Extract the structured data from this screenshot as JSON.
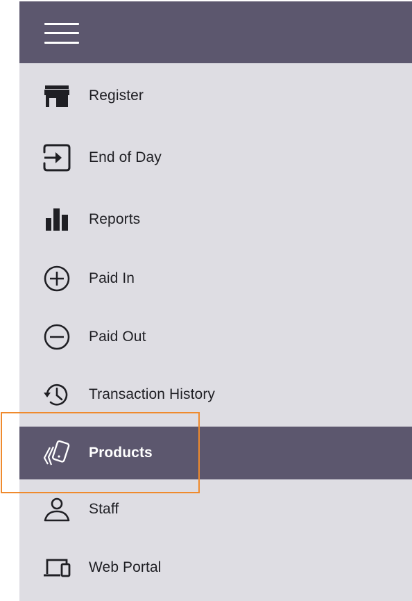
{
  "menu": {
    "toggle_icon": "hamburger-icon",
    "items": [
      {
        "label": "Register",
        "icon": "storefront-icon"
      },
      {
        "label": "End of Day",
        "icon": "exit-arrow-icon"
      },
      {
        "label": "Reports",
        "icon": "bar-chart-icon"
      },
      {
        "label": "Paid In",
        "icon": "plus-circle-icon"
      },
      {
        "label": "Paid Out",
        "icon": "minus-circle-icon"
      },
      {
        "label": "Transaction History",
        "icon": "history-icon"
      },
      {
        "label": "Products",
        "icon": "cards-icon",
        "active": true
      },
      {
        "label": "Staff",
        "icon": "person-icon"
      },
      {
        "label": "Web Portal",
        "icon": "devices-icon"
      }
    ]
  },
  "colors": {
    "header_bg": "#5c576e",
    "menu_bg": "#dedde3",
    "active_bg": "#5c576e",
    "highlight_border": "#ef8a2d",
    "text": "#1f1f24"
  }
}
